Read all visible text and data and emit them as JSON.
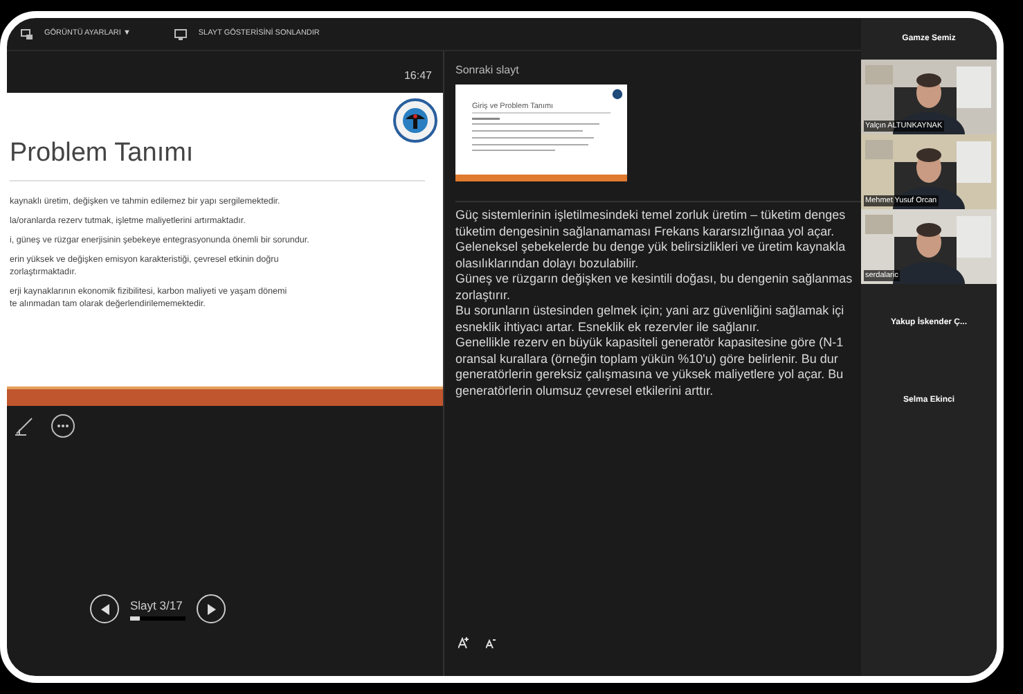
{
  "toolbar": {
    "items": [
      {
        "kind": "view",
        "label": "GÖRÜNTÜ AYARLARI ▼"
      },
      {
        "kind": "end",
        "label": "SLAYT GÖSTERİSİNİ SONLANDIR"
      }
    ]
  },
  "current_slide": {
    "time": "16:47",
    "title": "Problem Tanımı",
    "bullets": [
      [
        "kaynaklı üretim, değişken ve tahmin edilemez bir yapı sergilemektedir."
      ],
      [
        "la/oranlarda rezerv tutmak, işletme maliyetlerini artırmaktadır."
      ],
      [
        "i, güneş ve rüzgar enerjisinin şebekeye entegrasyonunda önemli bir sorundur."
      ],
      [
        "erin yüksek ve değişken emisyon karakteristiği, çevresel etkinin doğru",
        "zorlaştırmaktadır."
      ],
      [
        "erji kaynaklarının ekonomik fizibilitesi, karbon maliyeti ve yaşam dönemi",
        "te alınmadan tam olarak değerlendirilememektedir."
      ]
    ]
  },
  "navigation": {
    "slide_label": "Slayt 3/17",
    "level": 0.18
  },
  "next_slide": {
    "label": "Sonraki slayt",
    "title": "Giriş ve Problem Tanımı"
  },
  "notes": [
    "Güç sistemlerinin işletilmesindeki temel zorluk üretim – tüketim denges",
    "tüketim dengesinin sağlanamaması Frekans kararsızlığınaa yol açar.",
    "Geleneksel şebekelerde bu denge yük belirsizlikleri ve üretim kaynakla",
    "olasılıklarından dolayı bozulabilir.",
    "Güneş ve rüzgarın değişken ve kesintili doğası, bu dengenin sağlanmas",
    "zorlaştırır.",
    "Bu sorunların üstesinden gelmek için; yani arz güvenliğini sağlamak içi",
    "esneklik ihtiyacı artar. Esneklik ek rezervler ile sağlanır.",
    "Genellikle rezerv en büyük kapasiteli generatör kapasitesine göre (N-1",
    "oransal kurallara (örneğin toplam yükün %10'u) göre belirlenir. Bu dur",
    "generatörlerin gereksiz çalışmasına ve yüksek maliyetlere yol açar. Bu",
    "generatörlerin olumsuz çevresel etkilerini arttır."
  ],
  "participants": [
    {
      "name": "Gamze Semiz",
      "kind": "name"
    },
    {
      "name": "Yalçın ALTUNKAYNAK",
      "kind": "video"
    },
    {
      "name": "Mehmet Yusuf Orcan",
      "kind": "video"
    },
    {
      "name": "serdalaric",
      "kind": "video"
    },
    {
      "name": "Yakup İskender Ç...",
      "kind": "name"
    },
    {
      "name": "Selma Ekinci",
      "kind": "name"
    }
  ]
}
